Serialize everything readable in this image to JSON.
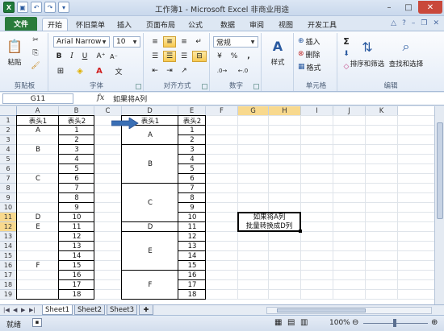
{
  "title": "工作簿1 - Microsoft Excel 非商业用途",
  "tabs": [
    "文件",
    "开始",
    "怀旧菜单",
    "插入",
    "页面布局",
    "公式",
    "数据",
    "审阅",
    "视图",
    "开发工具"
  ],
  "ribbon": {
    "paste": "粘贴",
    "clipboard": "剪贴板",
    "font_name": "Arial Narrow",
    "font_size": "10",
    "font_group": "字体",
    "align_group": "对齐方式",
    "number_format": "常规",
    "number_group": "数字",
    "style": "样式",
    "insert": "插入",
    "delete": "删除",
    "format": "格式",
    "cells_group": "单元格",
    "sort": "排序和筛选",
    "find": "查找和选择",
    "edit_group": "编辑",
    "bold": "B",
    "italic": "I",
    "underline": "U",
    "percent": "%",
    "comma": ",",
    "sigma": "Σ"
  },
  "formula_bar": {
    "name_box": "G11",
    "fx": "fx",
    "content": "如果将A列"
  },
  "columns": [
    "A",
    "B",
    "C",
    "D",
    "E",
    "F",
    "G",
    "H",
    "I",
    "J",
    "K"
  ],
  "rows": [
    "1",
    "2",
    "3",
    "4",
    "5",
    "6",
    "7",
    "8",
    "9",
    "10",
    "11",
    "12",
    "13",
    "14",
    "15",
    "16",
    "17",
    "18",
    "19"
  ],
  "table_left": {
    "headers": [
      "表头1",
      "表头2"
    ],
    "a_values": [
      [
        "A",
        2
      ],
      [
        "B",
        4
      ],
      [
        "C",
        7
      ],
      [
        "D",
        11
      ],
      [
        "E",
        12
      ],
      [
        "F",
        16
      ]
    ],
    "b_values": [
      "1",
      "2",
      "3",
      "4",
      "5",
      "6",
      "7",
      "8",
      "9",
      "10",
      "11",
      "12",
      "13",
      "14",
      "15",
      "16",
      "17",
      "18"
    ]
  },
  "table_right": {
    "headers": [
      "表头1",
      "表头2"
    ],
    "merged": [
      [
        "A",
        2,
        3
      ],
      [
        "B",
        4,
        7
      ],
      [
        "C",
        8,
        11
      ],
      [
        "D",
        12,
        12
      ],
      [
        "E",
        13,
        16
      ],
      [
        "F",
        17,
        19
      ]
    ],
    "e_values": [
      "1",
      "2",
      "3",
      "4",
      "5",
      "6",
      "7",
      "8",
      "9",
      "10",
      "11",
      "12",
      "13",
      "14",
      "15",
      "16",
      "17",
      "18"
    ]
  },
  "note": {
    "line1": "如果将A列",
    "line2": "批量转换成D列"
  },
  "sheets": [
    "Sheet1",
    "Sheet2",
    "Sheet3"
  ],
  "status": {
    "ready": "就绪",
    "zoom": "100%"
  },
  "colors": {
    "file_tab": "#2a7b3b",
    "arrow": "#3a6fb5",
    "selected_header": "#f8d98e"
  }
}
